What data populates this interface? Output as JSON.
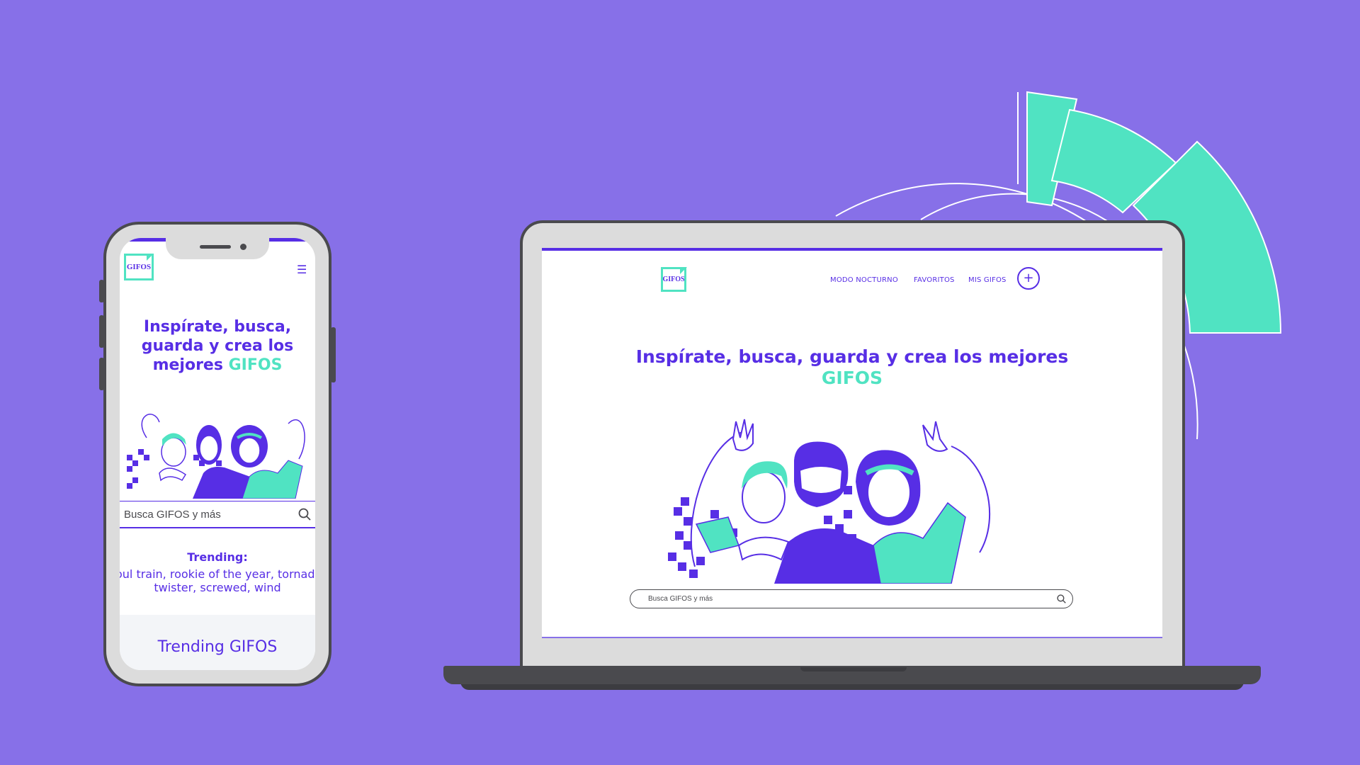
{
  "colors": {
    "background": "#8770e8",
    "brand_purple": "#572ee5",
    "brand_teal": "#50e3c2",
    "device_frame": "#4a4a4e",
    "device_bezel": "#dcdcdc"
  },
  "logo": {
    "text": "GIFOS"
  },
  "mobile": {
    "menu_icon": "hamburger-icon",
    "hero": {
      "title_lines": [
        "Inspírate, busca,",
        "guarda y crea los",
        "mejores "
      ],
      "title_accent": "GIFOS"
    },
    "search": {
      "placeholder": "Busca GIFOS y más",
      "icon": "search-icon"
    },
    "trending": {
      "label": "Trending:",
      "terms_line1": "soul train, rookie of the year, tornado,",
      "terms_line2": "twister, screwed, wind"
    },
    "section_title": "Trending GIFOS"
  },
  "desktop": {
    "nav": {
      "items": [
        {
          "label": "MODO NOCTURNO"
        },
        {
          "label": "FAVORITOS"
        },
        {
          "label": "MIS GIFOS"
        }
      ],
      "create_button": "+"
    },
    "hero": {
      "title": "Inspírate, busca, guarda y crea los mejores",
      "title_accent": "GIFOS"
    },
    "search": {
      "placeholder": "Busca GIFOS y más",
      "icon": "search-icon"
    }
  }
}
